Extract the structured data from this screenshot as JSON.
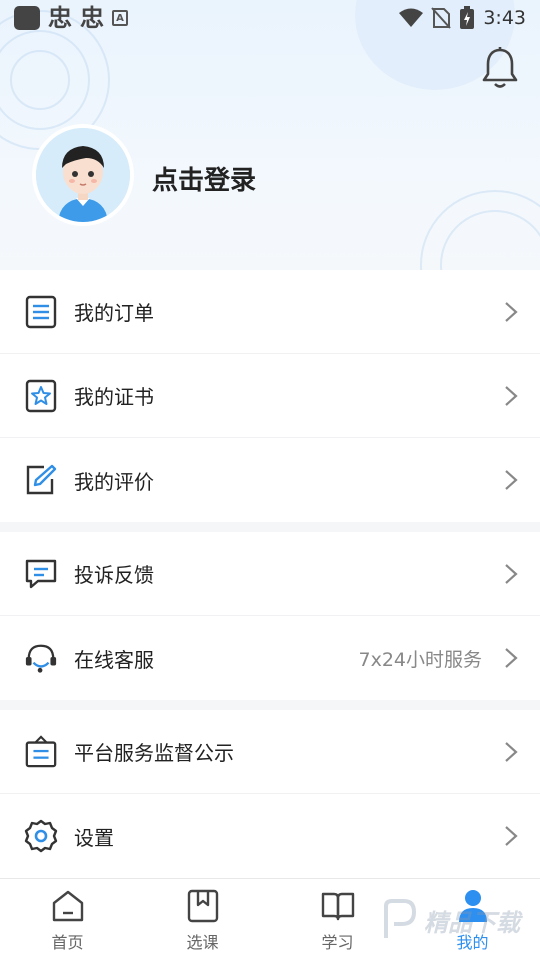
{
  "status_bar": {
    "time": "3:43",
    "left_glyph_1": "忠",
    "left_glyph_2": "忠",
    "left_badge": "A"
  },
  "profile": {
    "login_prompt": "点击登录"
  },
  "menu": {
    "group1": [
      {
        "label": "我的订单",
        "icon": "order-list-icon"
      },
      {
        "label": "我的证书",
        "icon": "certificate-icon"
      },
      {
        "label": "我的评价",
        "icon": "edit-review-icon"
      }
    ],
    "group2": [
      {
        "label": "投诉反馈",
        "icon": "feedback-chat-icon"
      },
      {
        "label": "在线客服",
        "icon": "headset-icon",
        "extra": "7x24小时服务"
      }
    ],
    "group3": [
      {
        "label": "平台服务监督公示",
        "icon": "notice-board-icon"
      },
      {
        "label": "设置",
        "icon": "settings-gear-icon"
      }
    ]
  },
  "bottom_nav": {
    "items": [
      {
        "label": "首页",
        "icon": "home-icon"
      },
      {
        "label": "选课",
        "icon": "bookmark-book-icon"
      },
      {
        "label": "学习",
        "icon": "open-book-icon"
      },
      {
        "label": "我的",
        "icon": "person-icon",
        "active": true
      }
    ]
  },
  "watermark": {
    "text": "精品下载"
  },
  "colors": {
    "accent": "#2d8ff0",
    "icon_blue": "#2f8fe6",
    "icon_dark": "#333333"
  }
}
